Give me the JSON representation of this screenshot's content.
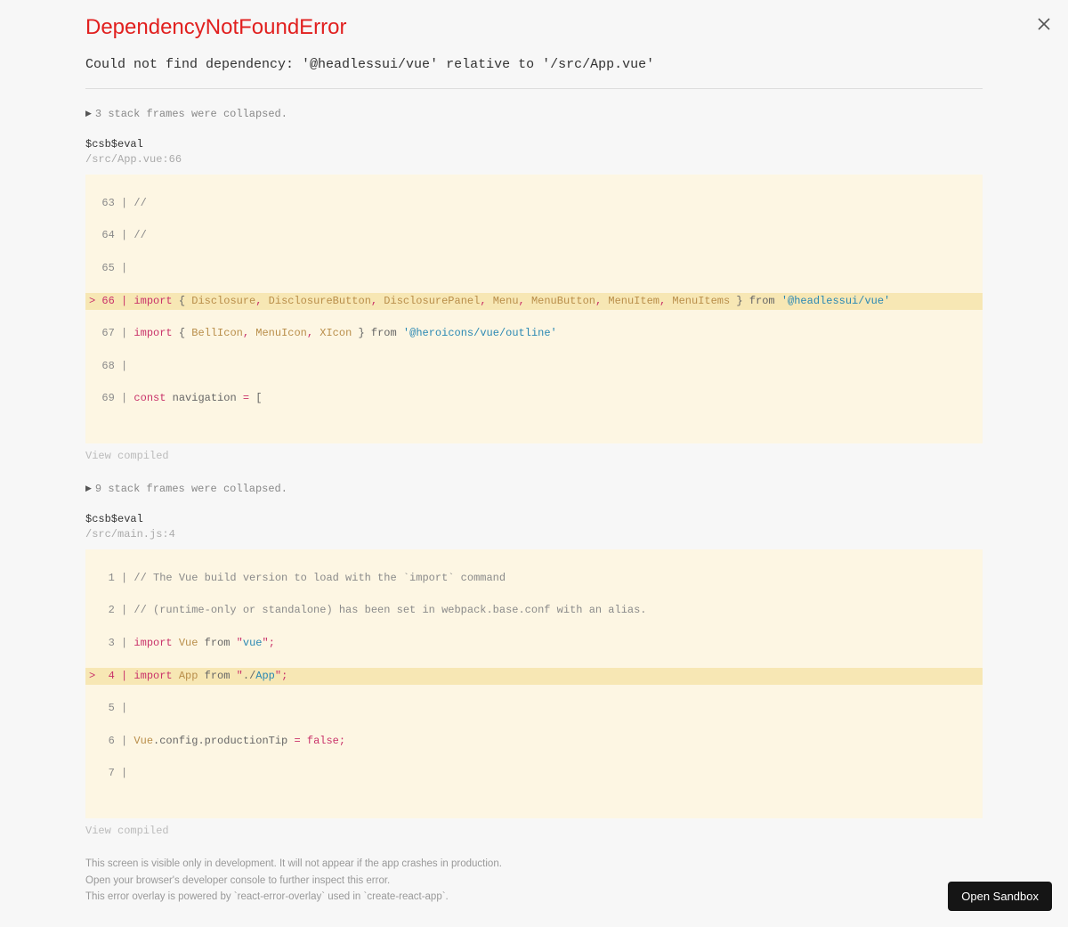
{
  "title": "DependencyNotFoundError",
  "message": "Could not find dependency: '@headlessui/vue' relative to '/src/App.vue'",
  "collapse1": "3 stack frames were collapsed.",
  "collapse2": "9 stack frames were collapsed.",
  "frame1": {
    "name": "$csb$eval",
    "loc": "/src/App.vue:66",
    "code": {
      "l63": "  63 | //",
      "l64": "  64 | //",
      "l65": "  65 | ",
      "h66": {
        "ptr": "> 66 | ",
        "kw1": "import",
        "brace1": " { ",
        "n1": "Disclosure",
        "c1": ", ",
        "n2": "DisclosureButton",
        "c2": ", ",
        "n3": "DisclosurePanel",
        "c3": ", ",
        "n4": "Menu",
        "c4": ", ",
        "n5": "MenuButton",
        "c5": ", ",
        "n6": "MenuItem",
        "c6": ", ",
        "n7": "MenuItems",
        "brace2": " } ",
        "from": "from ",
        "str": "'@headlessui/vue'"
      },
      "l67": {
        "g": "  67 | ",
        "kw1": "import",
        "brace1": " { ",
        "n1": "BellIcon",
        "c1": ", ",
        "n2": "MenuIcon",
        "c2": ", ",
        "n3": "XIcon",
        "brace2": " } ",
        "from": "from ",
        "str": "'@heroicons/vue/outline'"
      },
      "l68": "  68 | ",
      "l69": {
        "g": "  69 | ",
        "kw1": "const",
        "nm": " navigation ",
        "eq": "= ",
        "br": "["
      }
    }
  },
  "view_compiled": "View compiled",
  "frame2": {
    "name": "$csb$eval",
    "loc": "/src/main.js:4",
    "code": {
      "l1": "   1 | // The Vue build version to load with the `import` command",
      "l2": "   2 | // (runtime-only or standalone) has been set in webpack.base.conf with an alias.",
      "l3": {
        "g": "   3 | ",
        "kw": "import",
        "nm": " Vue ",
        "from": "from ",
        "q1": "\"",
        "str": "vue",
        "q2": "\"",
        "semi": ";"
      },
      "h4": {
        "ptr": ">  4 | ",
        "kw": "import",
        "nm": " App ",
        "from": "from ",
        "q1": "\"",
        "dot": "./",
        "str": "App",
        "q2": "\"",
        "semi": ";"
      },
      "l5": "   5 | ",
      "l6": {
        "g": "   6 | ",
        "nm": "Vue",
        "dot1": ".config.productionTip ",
        "eq": "= ",
        "val": "false",
        "semi": ";"
      },
      "l7": "   7 | "
    }
  },
  "footer": {
    "l1": "This screen is visible only in development. It will not appear if the app crashes in production.",
    "l2": "Open your browser's developer console to further inspect this error.",
    "l3": "This error overlay is powered by `react-error-overlay` used in `create-react-app`."
  },
  "open_sandbox": "Open Sandbox"
}
